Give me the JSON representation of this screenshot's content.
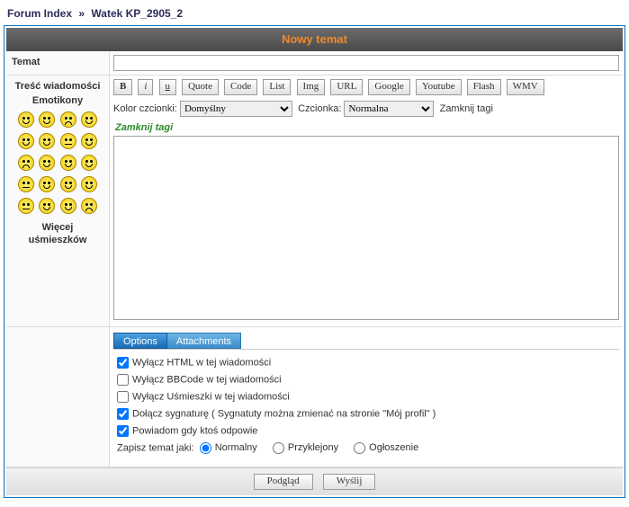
{
  "breadcrumb": {
    "index_label": "Forum Index",
    "sep": "»",
    "thread_label": "Watek KP_2905_2"
  },
  "header": {
    "title": "Nowy temat"
  },
  "labels": {
    "topic": "Temat",
    "body": "Treść wiadomości",
    "emoticons": "Emotikony",
    "more_smileys": "Więcej uśmieszków"
  },
  "toolbar": {
    "buttons": [
      "B",
      "i",
      "u",
      "Quote",
      "Code",
      "List",
      "Img",
      "URL",
      "Google",
      "Youtube",
      "Flash",
      "WMV"
    ],
    "font_color_label": "Kolor czcionki:",
    "font_color_value": "Domyślny",
    "font_label": "Czcionka:",
    "font_value": "Normalna",
    "close_tags": "Zamknij tagi",
    "close_tags_2": "Zamknij tagi"
  },
  "tabs": {
    "options": "Options",
    "attachments": "Attachments"
  },
  "options": {
    "disable_html": "Wyłącz HTML w tej wiadomości",
    "disable_bbcode": "Wyłącz BBCode w tej wiadomości",
    "disable_smilies": "Wyłącz Uśmieszki w tej wiadomości",
    "attach_sig": "Dołącz sygnaturę ( Sygnatuty można zmienać na stronie \"Mój profil\" )",
    "notify": "Powiadom gdy ktoś odpowie",
    "save_as_label": "Zapisz temat jaki:",
    "type_normal": "Normalny",
    "type_sticky": "Przyklejony",
    "type_announce": "Ogłoszenie"
  },
  "footer": {
    "preview": "Podgląd",
    "submit": "Wyślij"
  },
  "form": {
    "topic_value": "",
    "message_value": ""
  }
}
